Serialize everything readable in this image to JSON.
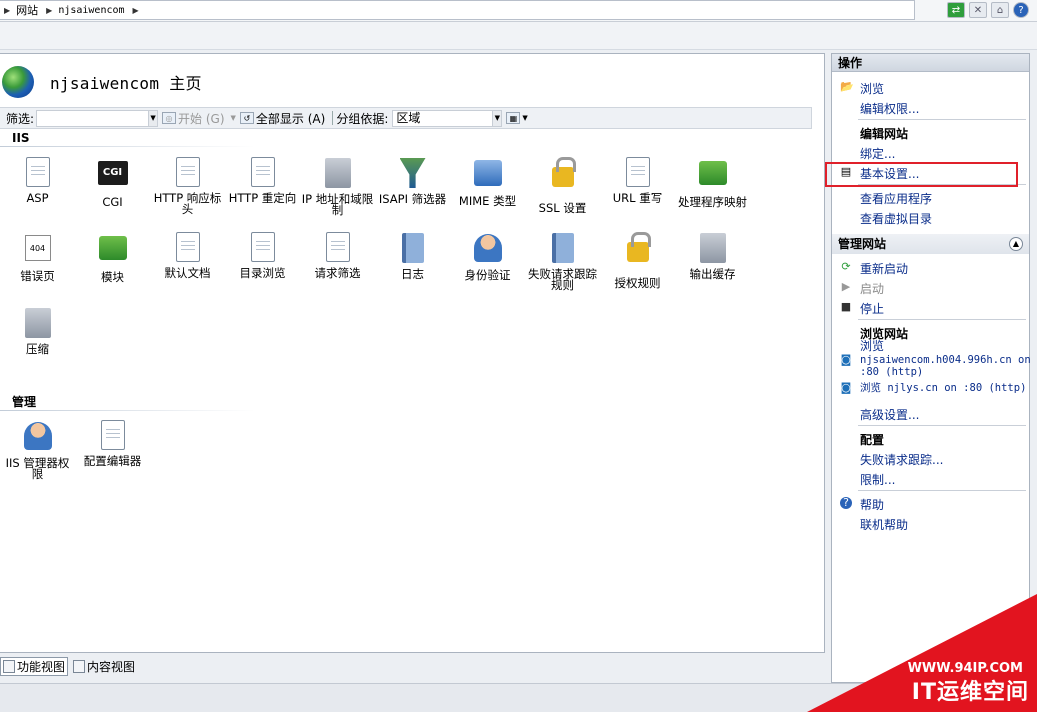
{
  "breadcrumb": {
    "items": [
      "网站",
      "njsaiwencom"
    ]
  },
  "page": {
    "title": "njsaiwencom 主页"
  },
  "toolbar": {
    "filter_label": "筛选:",
    "filter_value": "",
    "start_label": "开始 (G)",
    "show_all_label": "全部显示 (A)",
    "group_by_label": "分组依据:",
    "group_by_value": "区域"
  },
  "sections": {
    "iis": {
      "title": "IIS",
      "features": [
        {
          "label": "ASP",
          "icon": "asp-icon"
        },
        {
          "label": "CGI",
          "icon": "cgi-icon"
        },
        {
          "label": "HTTP 响应标头",
          "icon": "http-response-headers-icon"
        },
        {
          "label": "HTTP 重定向",
          "icon": "http-redirect-icon"
        },
        {
          "label": "IP 地址和域限制",
          "icon": "ip-domain-restrictions-icon"
        },
        {
          "label": "ISAPI 筛选器",
          "icon": "isapi-filters-icon"
        },
        {
          "label": "MIME 类型",
          "icon": "mime-types-icon"
        },
        {
          "label": "SSL 设置",
          "icon": "ssl-settings-icon"
        },
        {
          "label": "URL 重写",
          "icon": "url-rewrite-icon"
        },
        {
          "label": "处理程序映射",
          "icon": "handler-mappings-icon"
        },
        {
          "label": "错误页",
          "icon": "error-pages-icon"
        },
        {
          "label": "模块",
          "icon": "modules-icon"
        },
        {
          "label": "默认文档",
          "icon": "default-document-icon"
        },
        {
          "label": "目录浏览",
          "icon": "directory-browsing-icon"
        },
        {
          "label": "请求筛选",
          "icon": "request-filtering-icon"
        },
        {
          "label": "日志",
          "icon": "logging-icon"
        },
        {
          "label": "身份验证",
          "icon": "authentication-icon"
        },
        {
          "label": "失败请求跟踪规则",
          "icon": "failed-request-tracing-icon"
        },
        {
          "label": "授权规则",
          "icon": "authorization-rules-icon"
        },
        {
          "label": "输出缓存",
          "icon": "output-caching-icon"
        },
        {
          "label": "压缩",
          "icon": "compression-icon"
        }
      ]
    },
    "management": {
      "title": "管理",
      "features": [
        {
          "label": "IIS 管理器权限",
          "icon": "iis-manager-permissions-icon"
        },
        {
          "label": "配置编辑器",
          "icon": "configuration-editor-icon"
        }
      ]
    }
  },
  "bottom_tabs": {
    "features_view": "功能视图",
    "content_view": "内容视图"
  },
  "actions": {
    "header": "操作",
    "explore": "浏览",
    "edit_permissions": "编辑权限...",
    "edit_site_title": "编辑网站",
    "bindings": "绑定...",
    "basic_settings": "基本设置...",
    "view_applications": "查看应用程序",
    "view_virtual_dirs": "查看虚拟目录",
    "manage_site_title": "管理网站",
    "restart": "重新启动",
    "start": "启动",
    "stop": "停止",
    "browse_site_title": "浏览网站",
    "browse_label": "浏览",
    "browse_link_1": "njsaiwencom.h004.996h.cn on",
    "browse_link_1_port": ":80 (http)",
    "browse_link_2": "浏览 njlys.cn on :80 (http)",
    "advanced_settings": "高级设置...",
    "configure_title": "配置",
    "failed_request_tracing": "失败请求跟踪...",
    "limits": "限制...",
    "help": "帮助",
    "online_help": "联机帮助"
  },
  "watermark": {
    "url": "WWW.94IP.COM",
    "text": "IT运维空间"
  }
}
